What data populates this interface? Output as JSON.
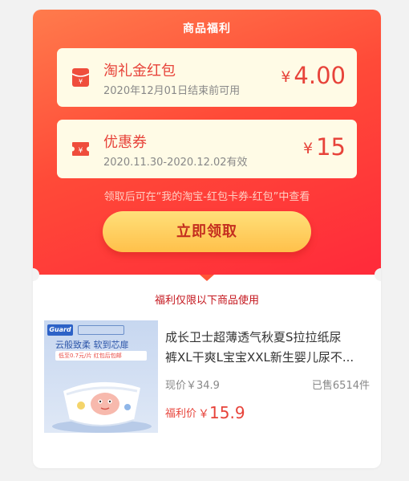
{
  "header": {
    "title": "商品福利"
  },
  "coupons": [
    {
      "icon": "red-envelope-icon",
      "name": "淘礼金红包",
      "desc": "2020年12月01日结束前可用",
      "currency": "¥",
      "amount": "4.00"
    },
    {
      "icon": "coupon-ticket-icon",
      "name": "优惠券",
      "desc": "2020.11.30-2020.12.02有效",
      "currency": "¥",
      "amount": "15"
    }
  ],
  "tip": "领取后可在“我的淘宝-红包卡券-红包”中查看",
  "claim_button": "立即领取",
  "product_section": {
    "subtitle": "福利仅限以下商品使用",
    "image": {
      "brand": "Guard",
      "tagline": "云般致柔 软到芯扉",
      "promo": "低至0.7元/片 红包后包邮"
    },
    "name_line1": "成长卫士超薄透气秋夏S拉拉纸尿",
    "name_line2": "裤XL干爽L宝宝XXL新生婴儿尿不...",
    "original_price": "现价￥34.9",
    "sold": "已售6514件",
    "deal_label": "福利价",
    "deal_currency": "￥",
    "deal_price": "15.9"
  },
  "colors": {
    "accent_red": "#e7433a",
    "header_gradient_start": "#ff7b4c",
    "header_gradient_end": "#ff2a3a",
    "coupon_bg": "#fffbe6",
    "button_gold": "#ffc04a"
  }
}
